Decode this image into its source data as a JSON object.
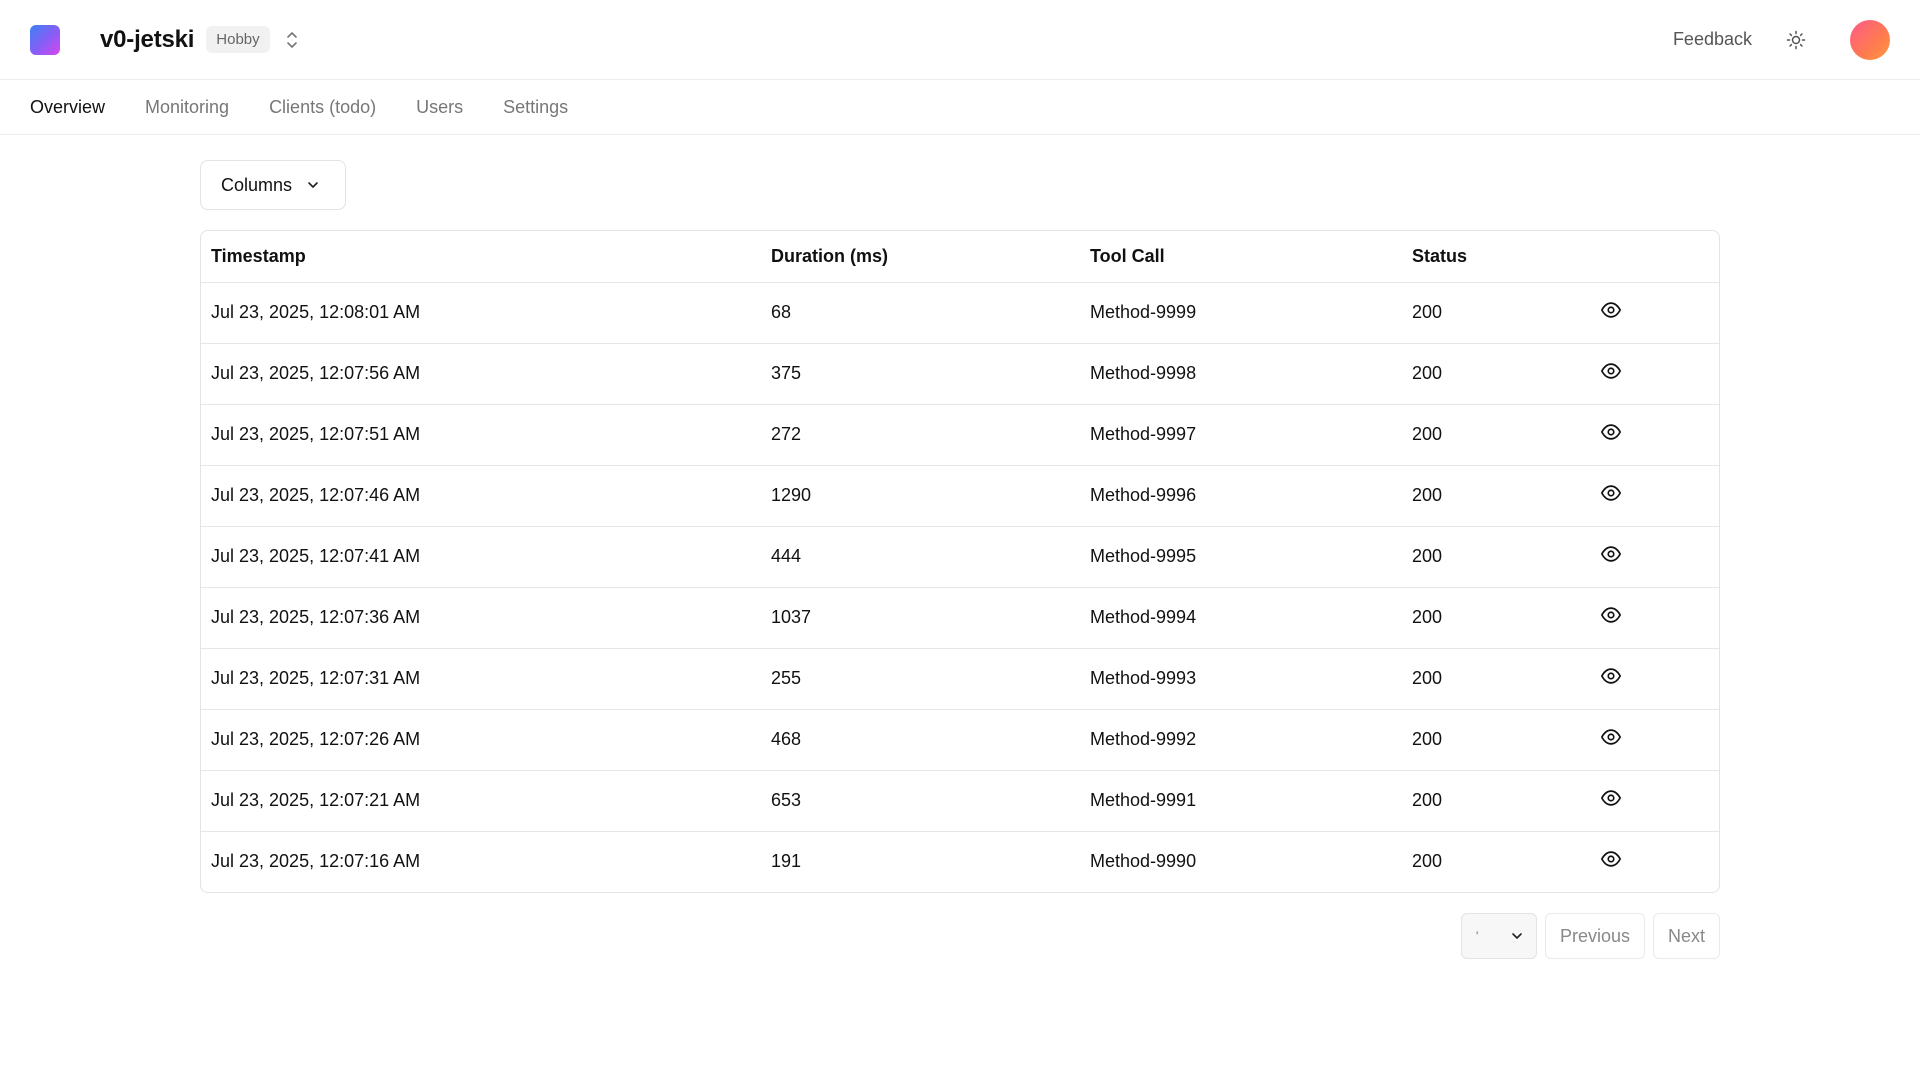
{
  "header": {
    "project_name": "v0-jetski",
    "plan_badge": "Hobby",
    "feedback_label": "Feedback"
  },
  "nav": {
    "tabs": [
      {
        "label": "Overview",
        "active": true
      },
      {
        "label": "Monitoring",
        "active": false
      },
      {
        "label": "Clients (todo)",
        "active": false
      },
      {
        "label": "Users",
        "active": false
      },
      {
        "label": "Settings",
        "active": false
      }
    ]
  },
  "toolbar": {
    "columns_label": "Columns"
  },
  "table": {
    "headers": [
      "Timestamp",
      "Duration (ms)",
      "Tool Call",
      "Status"
    ],
    "rows": [
      {
        "timestamp": "Jul 23, 2025, 12:08:01 AM",
        "duration": "68",
        "tool_call": "Method-9999",
        "status": "200"
      },
      {
        "timestamp": "Jul 23, 2025, 12:07:56 AM",
        "duration": "375",
        "tool_call": "Method-9998",
        "status": "200"
      },
      {
        "timestamp": "Jul 23, 2025, 12:07:51 AM",
        "duration": "272",
        "tool_call": "Method-9997",
        "status": "200"
      },
      {
        "timestamp": "Jul 23, 2025, 12:07:46 AM",
        "duration": "1290",
        "tool_call": "Method-9996",
        "status": "200"
      },
      {
        "timestamp": "Jul 23, 2025, 12:07:41 AM",
        "duration": "444",
        "tool_call": "Method-9995",
        "status": "200"
      },
      {
        "timestamp": "Jul 23, 2025, 12:07:36 AM",
        "duration": "1037",
        "tool_call": "Method-9994",
        "status": "200"
      },
      {
        "timestamp": "Jul 23, 2025, 12:07:31 AM",
        "duration": "255",
        "tool_call": "Method-9993",
        "status": "200"
      },
      {
        "timestamp": "Jul 23, 2025, 12:07:26 AM",
        "duration": "468",
        "tool_call": "Method-9992",
        "status": "200"
      },
      {
        "timestamp": "Jul 23, 2025, 12:07:21 AM",
        "duration": "653",
        "tool_call": "Method-9991",
        "status": "200"
      },
      {
        "timestamp": "Jul 23, 2025, 12:07:16 AM",
        "duration": "191",
        "tool_call": "Method-9990",
        "status": "200"
      }
    ]
  },
  "pagination": {
    "page_size_value": "'",
    "previous_label": "Previous",
    "next_label": "Next"
  },
  "icons": {
    "logo": "app-logo",
    "switcher": "chevrons-up-down-icon",
    "theme": "sun-icon",
    "row_action": "eye-icon",
    "dropdown": "chevron-down-icon"
  },
  "colors": {
    "logo_gradient": [
      "#3b82f6",
      "#8b5cf6",
      "#d946ef"
    ],
    "avatar_gradient": [
      "#ff5a8a",
      "#ff7a4f",
      "#ff9a3c"
    ]
  }
}
